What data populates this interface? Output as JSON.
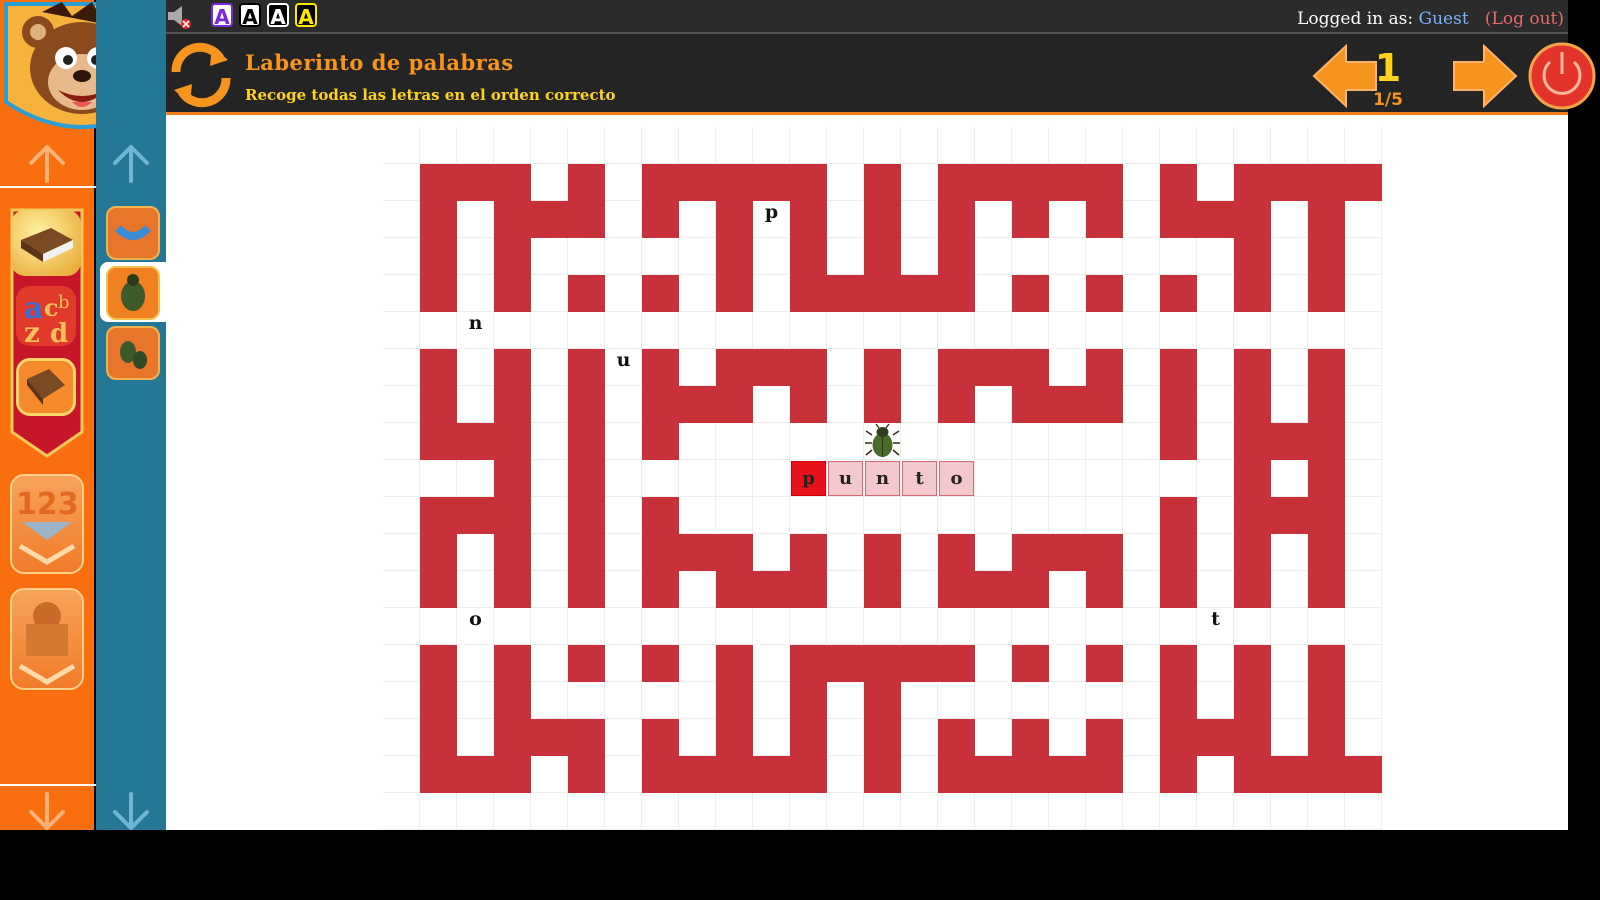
{
  "topbar": {
    "sound_icon": "sound-muted-icon",
    "font_buttons": [
      {
        "label": "A",
        "bg": "#ffffff",
        "fg": "#7a2bd1",
        "border": "#7a2bd1"
      },
      {
        "label": "A",
        "bg": "#ffffff",
        "fg": "#000000",
        "border": "#000000"
      },
      {
        "label": "A",
        "bg": "#000000",
        "fg": "#ffffff",
        "border": "#ffffff"
      },
      {
        "label": "A",
        "bg": "#000000",
        "fg": "#ffe600",
        "border": "#ffe600"
      }
    ],
    "login_prefix": "Logged in as:",
    "user": "Guest",
    "logout": "(Log out)"
  },
  "header": {
    "title": "Laberinto de palabras",
    "subtitle": "Recoge todas las letras en el orden correcto",
    "level": "1",
    "page": "1/5"
  },
  "sidebar": {
    "categories": [
      "book-icon",
      "alphabet-icon",
      "dictionary-icon",
      "numbers-icon",
      "mascot-box-icon"
    ],
    "thumbnails": [
      "worm-icon",
      "beetle-icon",
      "beetles-icon"
    ],
    "selected_thumbnail": 1
  },
  "game": {
    "word": "punto",
    "collected": 1,
    "maze_rows": [
      "...........................",
      ".###.#.#####.#.#####.#.####",
      ".#.###.#.#.#.#.#.#.#.###.#.",
      ".#.#.....#.#.#.#.......#.#.",
      ".#.#.#.#.#.#####.#.#.#.#.#.",
      "...........................",
      ".#.#.#.#.###.#.###.#.#.#.#.",
      ".#.#.#.###.#.#.#.###.#.#.#.",
      ".###.#.#.............#.###.",
      "...#.#.................#.#.",
      ".###.#.#.............#.###.",
      ".#.#.#.###.#.#.#.###.#.#.#.",
      ".#.#.#.#.###.#.###.#.#.#.#.",
      "...........................",
      ".#.#.#.#.#.#####.#.#.#.#.#.",
      ".#.#.....#.#.#.......#.#.#.",
      ".#.###.#.#.#.#.#.#.#.###.#.",
      ".###.#.#####.#.#####.#.####",
      "..........................."
    ],
    "letters": [
      {
        "char": "p",
        "row": 2,
        "col": 10
      },
      {
        "char": "n",
        "row": 5,
        "col": 2
      },
      {
        "char": "u",
        "row": 6,
        "col": 6
      },
      {
        "char": "o",
        "row": 13,
        "col": 2
      },
      {
        "char": "t",
        "row": 13,
        "col": 22
      }
    ],
    "word_row": 9,
    "word_col": 11,
    "bug_row": 8,
    "bug_col": 13,
    "wall_color": "#c8313a"
  }
}
